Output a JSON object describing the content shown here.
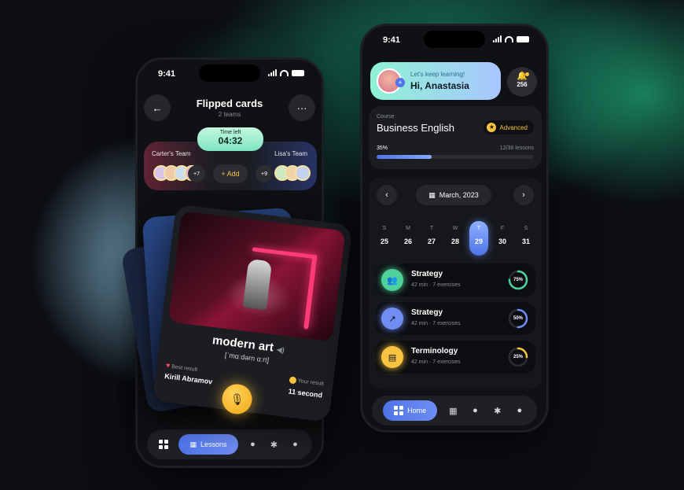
{
  "left_phone": {
    "status_time": "9:41",
    "title": "Flipped cards",
    "subtitle": "2 teams",
    "timer_label": "Time left",
    "timer_value": "04:32",
    "team_left": "Carter's Team",
    "team_right": "Lisa's Team",
    "team_left_more": "+7",
    "team_right_more": "+9",
    "add_label": "+ Add",
    "card": {
      "word": "modern art",
      "phonetic": "[ˈmɑːdərn ɑːrt]",
      "best_label": "Best result",
      "best_name": "Kirill Abramov",
      "your_label": "Your result",
      "your_value": "11 second"
    },
    "tabbar": {
      "active_label": "Lessons"
    }
  },
  "right_phone": {
    "status_time": "9:41",
    "greeting_line1": "Let's keep learning!",
    "greeting_line2": "Hi, Anastasia",
    "bell_count": "256",
    "course": {
      "label": "Course",
      "name": "Business English",
      "level": "Advanced",
      "progress_text": "35%",
      "progress": 0.35,
      "lessons_text": "12/38 lessons"
    },
    "calendar": {
      "month": "March, 2023",
      "days": [
        {
          "name": "S",
          "date": "25"
        },
        {
          "name": "M",
          "date": "26"
        },
        {
          "name": "T",
          "date": "27"
        },
        {
          "name": "W",
          "date": "28"
        },
        {
          "name": "T",
          "date": "29"
        },
        {
          "name": "F",
          "date": "30"
        },
        {
          "name": "S",
          "date": "31"
        }
      ],
      "active_index": 4
    },
    "lessons": [
      {
        "title": "Strategy",
        "meta": "42 min  ·  7 exercises",
        "percent_text": "75%",
        "percent": 0.75,
        "color": "#4fd19a",
        "ring": "#4fd19a"
      },
      {
        "title": "Strategy",
        "meta": "42 min  ·  7 exercises",
        "percent_text": "50%",
        "percent": 0.5,
        "color": "#6f8df2",
        "ring": "#6f8df2"
      },
      {
        "title": "Terminology",
        "meta": "42 min  ·  7 exercises",
        "percent_text": "25%",
        "percent": 0.25,
        "color": "#f7c340",
        "ring": "#f7c340"
      }
    ],
    "tabbar": {
      "active_label": "Home"
    }
  }
}
